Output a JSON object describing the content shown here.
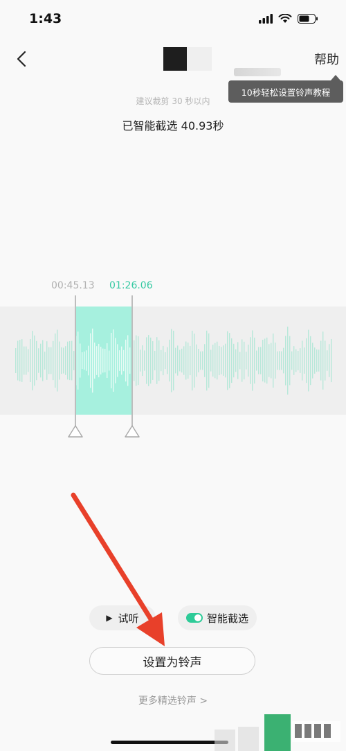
{
  "status_bar": {
    "time": "1:43"
  },
  "nav": {
    "help_label": "帮助"
  },
  "tooltip": {
    "text": "10秒轻松设置铃声教程"
  },
  "hint": "建议裁剪 30 秒以内",
  "smart_text": "已智能截选 40.93秒",
  "selection": {
    "start": "00:45.13",
    "end": "01:26.06"
  },
  "controls": {
    "preview_label": "试听",
    "smart_label": "智能截选",
    "set_label": "设置为铃声",
    "more_label": "更多精选铃声 >"
  },
  "colors": {
    "accent": "#35c9a2",
    "selection": "#99f0da",
    "arrow": "#e8402a"
  }
}
